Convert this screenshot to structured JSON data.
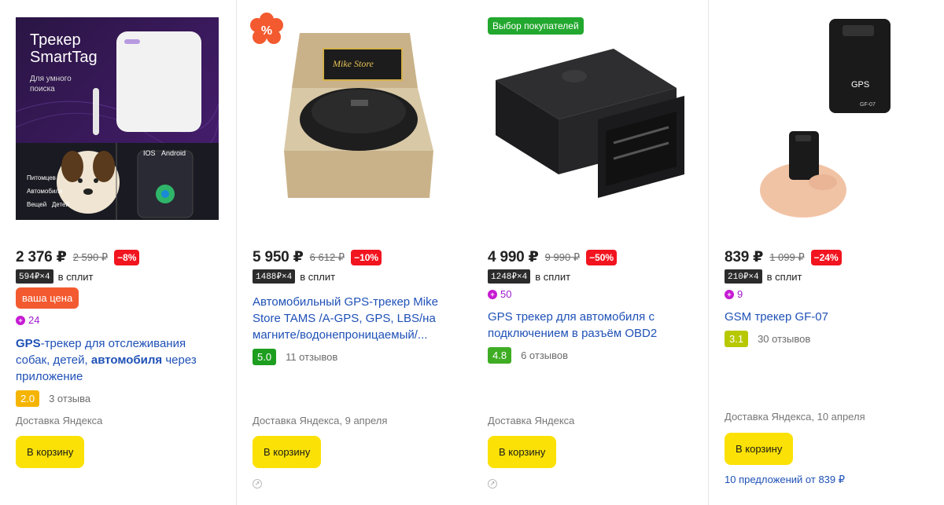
{
  "colors": {
    "link": "#1f51b6",
    "discount": "#f2141e",
    "cart": "#fbe106",
    "plus": "#c61bd3"
  },
  "products": [
    {
      "image": {
        "title_line1": "Трекер",
        "title_line2": "SmartTag",
        "subtitle_line1": "Для умного",
        "subtitle_line2": "поиска",
        "os1": "IOS",
        "os2": "Android",
        "tag1": "Питомцев",
        "tag2": "Автомобиля",
        "tag3": "Вещей",
        "tag4": "Детей"
      },
      "price": "2 376 ₽",
      "old_price": "2 590 ₽",
      "discount": "−8%",
      "split_chip": "594₽×4",
      "split_text": "в сплит",
      "your_price": "ваша цена",
      "plus_points": "24",
      "title_parts": [
        "GPS",
        "-трекер для отслеживания собак, детей, ",
        "автомобиля",
        " через приложение"
      ],
      "rating": "2.0",
      "rating_color": "#f5b400",
      "reviews": "3 отзыва",
      "delivery": "Доставка Яндекса",
      "cart_label": "В корзину"
    },
    {
      "image": {
        "box_label": "Mike Store"
      },
      "price": "5 950 ₽",
      "old_price": "6 612 ₽",
      "discount": "−10%",
      "split_chip": "1488₽×4",
      "split_text": "в сплит",
      "title": "Автомобильный GPS-трекер Mike Store TAMS /A-GPS, GPS, LBS/на магните/водонепроницаемый/...",
      "rating": "5.0",
      "rating_color": "#1d9e1f",
      "reviews": "11 отзывов",
      "delivery": "Доставка Яндекса, 9 апреля",
      "cart_label": "В корзину"
    },
    {
      "badge": "Выбор покупателей",
      "price": "4 990 ₽",
      "old_price": "9 990 ₽",
      "discount": "−50%",
      "split_chip": "1248₽×4",
      "split_text": "в сплит",
      "plus_points": "50",
      "title": "GPS трекер для автомобиля с подключением в разъём OBD2",
      "rating": "4.8",
      "rating_color": "#3fad23",
      "reviews": "6 отзывов",
      "delivery": "Доставка Яндекса",
      "cart_label": "В корзину"
    },
    {
      "image": {
        "device_label": "GPS",
        "model_label": "GF-07"
      },
      "price": "839 ₽",
      "old_price": "1 099 ₽",
      "discount": "−24%",
      "split_chip": "210₽×4",
      "split_text": "в сплит",
      "plus_points": "9",
      "title": "GSM трекер GF-07",
      "rating": "3.1",
      "rating_color": "#b7c800",
      "reviews": "30 отзывов",
      "delivery": "Доставка Яндекса, 10 апреля",
      "cart_label": "В корзину",
      "offers": "10 предложений от 839 ₽"
    }
  ],
  "sale_badge_icon": "percent-flower-icon"
}
